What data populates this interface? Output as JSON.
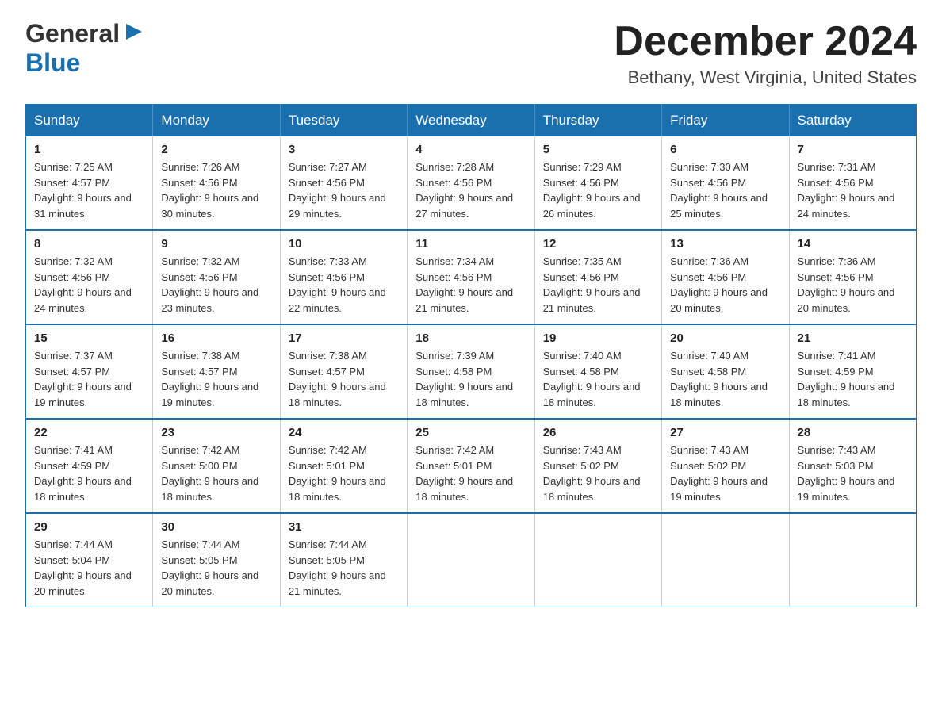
{
  "header": {
    "logo_general": "General",
    "logo_blue": "Blue",
    "month_title": "December 2024",
    "location": "Bethany, West Virginia, United States"
  },
  "weekdays": [
    "Sunday",
    "Monday",
    "Tuesday",
    "Wednesday",
    "Thursday",
    "Friday",
    "Saturday"
  ],
  "weeks": [
    [
      {
        "day": "1",
        "sunrise": "7:25 AM",
        "sunset": "4:57 PM",
        "daylight": "9 hours and 31 minutes."
      },
      {
        "day": "2",
        "sunrise": "7:26 AM",
        "sunset": "4:56 PM",
        "daylight": "9 hours and 30 minutes."
      },
      {
        "day": "3",
        "sunrise": "7:27 AM",
        "sunset": "4:56 PM",
        "daylight": "9 hours and 29 minutes."
      },
      {
        "day": "4",
        "sunrise": "7:28 AM",
        "sunset": "4:56 PM",
        "daylight": "9 hours and 27 minutes."
      },
      {
        "day": "5",
        "sunrise": "7:29 AM",
        "sunset": "4:56 PM",
        "daylight": "9 hours and 26 minutes."
      },
      {
        "day": "6",
        "sunrise": "7:30 AM",
        "sunset": "4:56 PM",
        "daylight": "9 hours and 25 minutes."
      },
      {
        "day": "7",
        "sunrise": "7:31 AM",
        "sunset": "4:56 PM",
        "daylight": "9 hours and 24 minutes."
      }
    ],
    [
      {
        "day": "8",
        "sunrise": "7:32 AM",
        "sunset": "4:56 PM",
        "daylight": "9 hours and 24 minutes."
      },
      {
        "day": "9",
        "sunrise": "7:32 AM",
        "sunset": "4:56 PM",
        "daylight": "9 hours and 23 minutes."
      },
      {
        "day": "10",
        "sunrise": "7:33 AM",
        "sunset": "4:56 PM",
        "daylight": "9 hours and 22 minutes."
      },
      {
        "day": "11",
        "sunrise": "7:34 AM",
        "sunset": "4:56 PM",
        "daylight": "9 hours and 21 minutes."
      },
      {
        "day": "12",
        "sunrise": "7:35 AM",
        "sunset": "4:56 PM",
        "daylight": "9 hours and 21 minutes."
      },
      {
        "day": "13",
        "sunrise": "7:36 AM",
        "sunset": "4:56 PM",
        "daylight": "9 hours and 20 minutes."
      },
      {
        "day": "14",
        "sunrise": "7:36 AM",
        "sunset": "4:56 PM",
        "daylight": "9 hours and 20 minutes."
      }
    ],
    [
      {
        "day": "15",
        "sunrise": "7:37 AM",
        "sunset": "4:57 PM",
        "daylight": "9 hours and 19 minutes."
      },
      {
        "day": "16",
        "sunrise": "7:38 AM",
        "sunset": "4:57 PM",
        "daylight": "9 hours and 19 minutes."
      },
      {
        "day": "17",
        "sunrise": "7:38 AM",
        "sunset": "4:57 PM",
        "daylight": "9 hours and 18 minutes."
      },
      {
        "day": "18",
        "sunrise": "7:39 AM",
        "sunset": "4:58 PM",
        "daylight": "9 hours and 18 minutes."
      },
      {
        "day": "19",
        "sunrise": "7:40 AM",
        "sunset": "4:58 PM",
        "daylight": "9 hours and 18 minutes."
      },
      {
        "day": "20",
        "sunrise": "7:40 AM",
        "sunset": "4:58 PM",
        "daylight": "9 hours and 18 minutes."
      },
      {
        "day": "21",
        "sunrise": "7:41 AM",
        "sunset": "4:59 PM",
        "daylight": "9 hours and 18 minutes."
      }
    ],
    [
      {
        "day": "22",
        "sunrise": "7:41 AM",
        "sunset": "4:59 PM",
        "daylight": "9 hours and 18 minutes."
      },
      {
        "day": "23",
        "sunrise": "7:42 AM",
        "sunset": "5:00 PM",
        "daylight": "9 hours and 18 minutes."
      },
      {
        "day": "24",
        "sunrise": "7:42 AM",
        "sunset": "5:01 PM",
        "daylight": "9 hours and 18 minutes."
      },
      {
        "day": "25",
        "sunrise": "7:42 AM",
        "sunset": "5:01 PM",
        "daylight": "9 hours and 18 minutes."
      },
      {
        "day": "26",
        "sunrise": "7:43 AM",
        "sunset": "5:02 PM",
        "daylight": "9 hours and 18 minutes."
      },
      {
        "day": "27",
        "sunrise": "7:43 AM",
        "sunset": "5:02 PM",
        "daylight": "9 hours and 19 minutes."
      },
      {
        "day": "28",
        "sunrise": "7:43 AM",
        "sunset": "5:03 PM",
        "daylight": "9 hours and 19 minutes."
      }
    ],
    [
      {
        "day": "29",
        "sunrise": "7:44 AM",
        "sunset": "5:04 PM",
        "daylight": "9 hours and 20 minutes."
      },
      {
        "day": "30",
        "sunrise": "7:44 AM",
        "sunset": "5:05 PM",
        "daylight": "9 hours and 20 minutes."
      },
      {
        "day": "31",
        "sunrise": "7:44 AM",
        "sunset": "5:05 PM",
        "daylight": "9 hours and 21 minutes."
      },
      null,
      null,
      null,
      null
    ]
  ],
  "labels": {
    "sunrise": "Sunrise:",
    "sunset": "Sunset:",
    "daylight": "Daylight:"
  }
}
